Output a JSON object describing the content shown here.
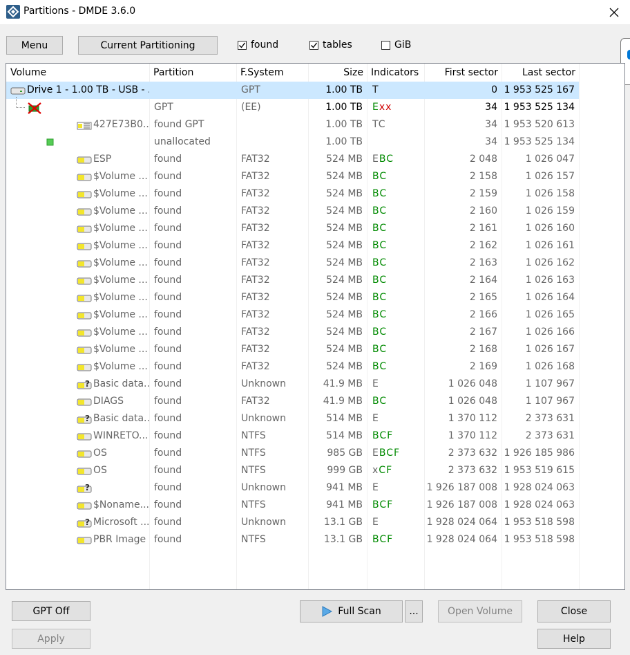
{
  "window": {
    "title": "Partitions - DMDE 3.6.0"
  },
  "toolbar": {
    "menu_label": "Menu",
    "current_partitioning_label": "Current Partitioning",
    "found_label": "found",
    "found_checked": true,
    "tables_label": "tables",
    "tables_checked": true,
    "gib_label": "GiB",
    "gib_checked": false
  },
  "columns": {
    "volume": "Volume",
    "partition": "Partition",
    "fsystem": "F.System",
    "size": "Size",
    "indicators": "Indicators",
    "first_sector": "First sector",
    "last_sector": "Last sector"
  },
  "rows": [
    {
      "volume": "Drive 1 - 1.00 TB - USB - ...",
      "partition": "",
      "fs": "GPT",
      "size": "1.00 TB",
      "ind": [
        {
          "t": "T",
          "c": "t"
        }
      ],
      "first": "0",
      "last": "1 953 525 167",
      "icon": "drive-icon",
      "indent": 0,
      "dark": true,
      "selected": true
    },
    {
      "volume": "",
      "partition": "GPT",
      "fs": "(EE)",
      "size": "1.00 TB",
      "ind": [
        {
          "t": "E",
          "c": "g"
        },
        {
          "t": "x",
          "c": "r"
        },
        {
          "t": "x",
          "c": "r"
        }
      ],
      "first": "34",
      "last": "1 953 525 134",
      "icon": "deleted-partition-icon",
      "indent": 1,
      "dark": true
    },
    {
      "volume": "427E73B0...",
      "partition": "found GPT",
      "fs": "",
      "size": "1.00 TB",
      "ind": [
        {
          "t": "TC",
          "c": "gr"
        }
      ],
      "first": "34",
      "last": "1 953 520 613",
      "icon": "partition-table-icon",
      "indent": 3
    },
    {
      "volume": "",
      "partition": "unallocated",
      "fs": "",
      "size": "1.00 TB",
      "ind": [],
      "first": "34",
      "last": "1 953 525 134",
      "icon": "unallocated-icon",
      "indent": 2
    },
    {
      "volume": "ESP",
      "partition": "found",
      "fs": "FAT32",
      "size": "524 MB",
      "ind": [
        {
          "t": "E",
          "c": "gr"
        },
        {
          "t": "BC",
          "c": "g"
        }
      ],
      "first": "2 048",
      "last": "1 026 047",
      "icon": "volume-icon",
      "indent": 3
    },
    {
      "volume": "$Volume ...",
      "partition": "found",
      "fs": "FAT32",
      "size": "524 MB",
      "ind": [
        {
          "t": "BC",
          "c": "g"
        }
      ],
      "first": "2 158",
      "last": "1 026 157",
      "icon": "volume-icon",
      "indent": 3
    },
    {
      "volume": "$Volume ...",
      "partition": "found",
      "fs": "FAT32",
      "size": "524 MB",
      "ind": [
        {
          "t": "BC",
          "c": "g"
        }
      ],
      "first": "2 159",
      "last": "1 026 158",
      "icon": "volume-icon",
      "indent": 3
    },
    {
      "volume": "$Volume ...",
      "partition": "found",
      "fs": "FAT32",
      "size": "524 MB",
      "ind": [
        {
          "t": "BC",
          "c": "g"
        }
      ],
      "first": "2 160",
      "last": "1 026 159",
      "icon": "volume-icon",
      "indent": 3
    },
    {
      "volume": "$Volume ...",
      "partition": "found",
      "fs": "FAT32",
      "size": "524 MB",
      "ind": [
        {
          "t": "BC",
          "c": "g"
        }
      ],
      "first": "2 161",
      "last": "1 026 160",
      "icon": "volume-icon",
      "indent": 3
    },
    {
      "volume": "$Volume ...",
      "partition": "found",
      "fs": "FAT32",
      "size": "524 MB",
      "ind": [
        {
          "t": "BC",
          "c": "g"
        }
      ],
      "first": "2 162",
      "last": "1 026 161",
      "icon": "volume-icon",
      "indent": 3
    },
    {
      "volume": "$Volume ...",
      "partition": "found",
      "fs": "FAT32",
      "size": "524 MB",
      "ind": [
        {
          "t": "BC",
          "c": "g"
        }
      ],
      "first": "2 163",
      "last": "1 026 162",
      "icon": "volume-icon",
      "indent": 3
    },
    {
      "volume": "$Volume ...",
      "partition": "found",
      "fs": "FAT32",
      "size": "524 MB",
      "ind": [
        {
          "t": "BC",
          "c": "g"
        }
      ],
      "first": "2 164",
      "last": "1 026 163",
      "icon": "volume-icon",
      "indent": 3
    },
    {
      "volume": "$Volume ...",
      "partition": "found",
      "fs": "FAT32",
      "size": "524 MB",
      "ind": [
        {
          "t": "BC",
          "c": "g"
        }
      ],
      "first": "2 165",
      "last": "1 026 164",
      "icon": "volume-icon",
      "indent": 3
    },
    {
      "volume": "$Volume ...",
      "partition": "found",
      "fs": "FAT32",
      "size": "524 MB",
      "ind": [
        {
          "t": "BC",
          "c": "g"
        }
      ],
      "first": "2 166",
      "last": "1 026 165",
      "icon": "volume-icon",
      "indent": 3
    },
    {
      "volume": "$Volume ...",
      "partition": "found",
      "fs": "FAT32",
      "size": "524 MB",
      "ind": [
        {
          "t": "BC",
          "c": "g"
        }
      ],
      "first": "2 167",
      "last": "1 026 166",
      "icon": "volume-icon",
      "indent": 3
    },
    {
      "volume": "$Volume ...",
      "partition": "found",
      "fs": "FAT32",
      "size": "524 MB",
      "ind": [
        {
          "t": "BC",
          "c": "g"
        }
      ],
      "first": "2 168",
      "last": "1 026 167",
      "icon": "volume-icon",
      "indent": 3
    },
    {
      "volume": "$Volume ...",
      "partition": "found",
      "fs": "FAT32",
      "size": "524 MB",
      "ind": [
        {
          "t": "BC",
          "c": "g"
        }
      ],
      "first": "2 169",
      "last": "1 026 168",
      "icon": "volume-icon",
      "indent": 3
    },
    {
      "volume": "Basic data...",
      "partition": "found",
      "fs": "Unknown",
      "size": "41.9 MB",
      "ind": [
        {
          "t": "E",
          "c": "gr"
        }
      ],
      "first": "1 026 048",
      "last": "1 107 967",
      "icon": "unknown-volume-icon",
      "indent": 3
    },
    {
      "volume": "DIAGS",
      "partition": "found",
      "fs": "FAT32",
      "size": "41.9 MB",
      "ind": [
        {
          "t": "BC",
          "c": "g"
        }
      ],
      "first": "1 026 048",
      "last": "1 107 967",
      "icon": "volume-icon",
      "indent": 3
    },
    {
      "volume": "Basic data...",
      "partition": "found",
      "fs": "Unknown",
      "size": "514 MB",
      "ind": [
        {
          "t": "E",
          "c": "gr"
        }
      ],
      "first": "1 370 112",
      "last": "2 373 631",
      "icon": "unknown-volume-icon",
      "indent": 3
    },
    {
      "volume": "WINRETO...",
      "partition": "found",
      "fs": "NTFS",
      "size": "514 MB",
      "ind": [
        {
          "t": "BCF",
          "c": "g"
        }
      ],
      "first": "1 370 112",
      "last": "2 373 631",
      "icon": "volume-icon",
      "indent": 3
    },
    {
      "volume": "OS",
      "partition": "found",
      "fs": "NTFS",
      "size": "985 GB",
      "ind": [
        {
          "t": "E",
          "c": "gr"
        },
        {
          "t": "BCF",
          "c": "g"
        }
      ],
      "first": "2 373 632",
      "last": "1 926 185 986",
      "icon": "volume-icon",
      "indent": 3
    },
    {
      "volume": "OS",
      "partition": "found",
      "fs": "NTFS",
      "size": "999 GB",
      "ind": [
        {
          "t": "x",
          "c": "gr"
        },
        {
          "t": "CF",
          "c": "g"
        }
      ],
      "first": "2 373 632",
      "last": "1 953 519 615",
      "icon": "volume-icon",
      "indent": 3
    },
    {
      "volume": "",
      "partition": "found",
      "fs": "Unknown",
      "size": "941 MB",
      "ind": [
        {
          "t": "E",
          "c": "gr"
        }
      ],
      "first": "1 926 187 008",
      "last": "1 928 024 063",
      "icon": "unknown-volume-icon",
      "indent": 3
    },
    {
      "volume": "$Noname...",
      "partition": "found",
      "fs": "NTFS",
      "size": "941 MB",
      "ind": [
        {
          "t": "BCF",
          "c": "g"
        }
      ],
      "first": "1 926 187 008",
      "last": "1 928 024 063",
      "icon": "volume-icon",
      "indent": 3
    },
    {
      "volume": "Microsoft ...",
      "partition": "found",
      "fs": "Unknown",
      "size": "13.1 GB",
      "ind": [
        {
          "t": "E",
          "c": "gr"
        }
      ],
      "first": "1 928 024 064",
      "last": "1 953 518 598",
      "icon": "unknown-volume-icon",
      "indent": 3
    },
    {
      "volume": "PBR Image",
      "partition": "found",
      "fs": "NTFS",
      "size": "13.1 GB",
      "ind": [
        {
          "t": "BCF",
          "c": "g"
        }
      ],
      "first": "1 928 024 064",
      "last": "1 953 518 598",
      "icon": "volume-icon",
      "indent": 3
    }
  ],
  "bottom": {
    "gpt_off": "GPT Off",
    "apply": "Apply",
    "full_scan": "Full Scan",
    "more": "...",
    "open_volume": "Open Volume",
    "close": "Close",
    "help": "Help"
  },
  "colors": {
    "selection": "#cce8ff",
    "green_indicator": "#008a00",
    "red_indicator": "#d00000",
    "accent": "#0078d7"
  }
}
